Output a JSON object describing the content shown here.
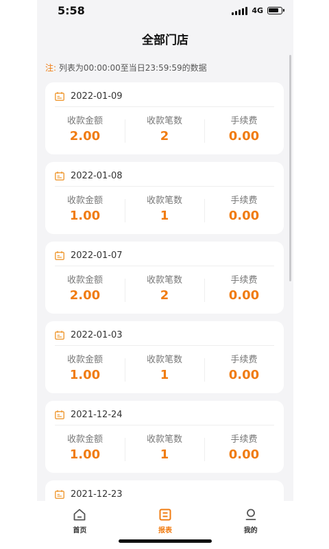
{
  "status_bar": {
    "time": "5:58",
    "network": "4G"
  },
  "page": {
    "title": "全部门店"
  },
  "notice": {
    "prefix": "注:",
    "text": "列表为00:00:00至当日23:59:59的数据"
  },
  "stat_labels": {
    "amount": "收款金额",
    "count": "收款笔数",
    "fee": "手续费"
  },
  "records": [
    {
      "date": "2022-01-09",
      "amount": "2.00",
      "count": "2",
      "fee": "0.00"
    },
    {
      "date": "2022-01-08",
      "amount": "1.00",
      "count": "1",
      "fee": "0.00"
    },
    {
      "date": "2022-01-07",
      "amount": "2.00",
      "count": "2",
      "fee": "0.00"
    },
    {
      "date": "2022-01-03",
      "amount": "1.00",
      "count": "1",
      "fee": "0.00"
    },
    {
      "date": "2021-12-24",
      "amount": "1.00",
      "count": "1",
      "fee": "0.00"
    },
    {
      "date": "2021-12-23"
    }
  ],
  "tabs": [
    {
      "label": "首页",
      "icon": "home-icon"
    },
    {
      "label": "报表",
      "icon": "report-icon",
      "active": true
    },
    {
      "label": "我的",
      "icon": "profile-icon"
    }
  ],
  "colors": {
    "accent": "#f07c12",
    "background": "#f4f4f6"
  }
}
